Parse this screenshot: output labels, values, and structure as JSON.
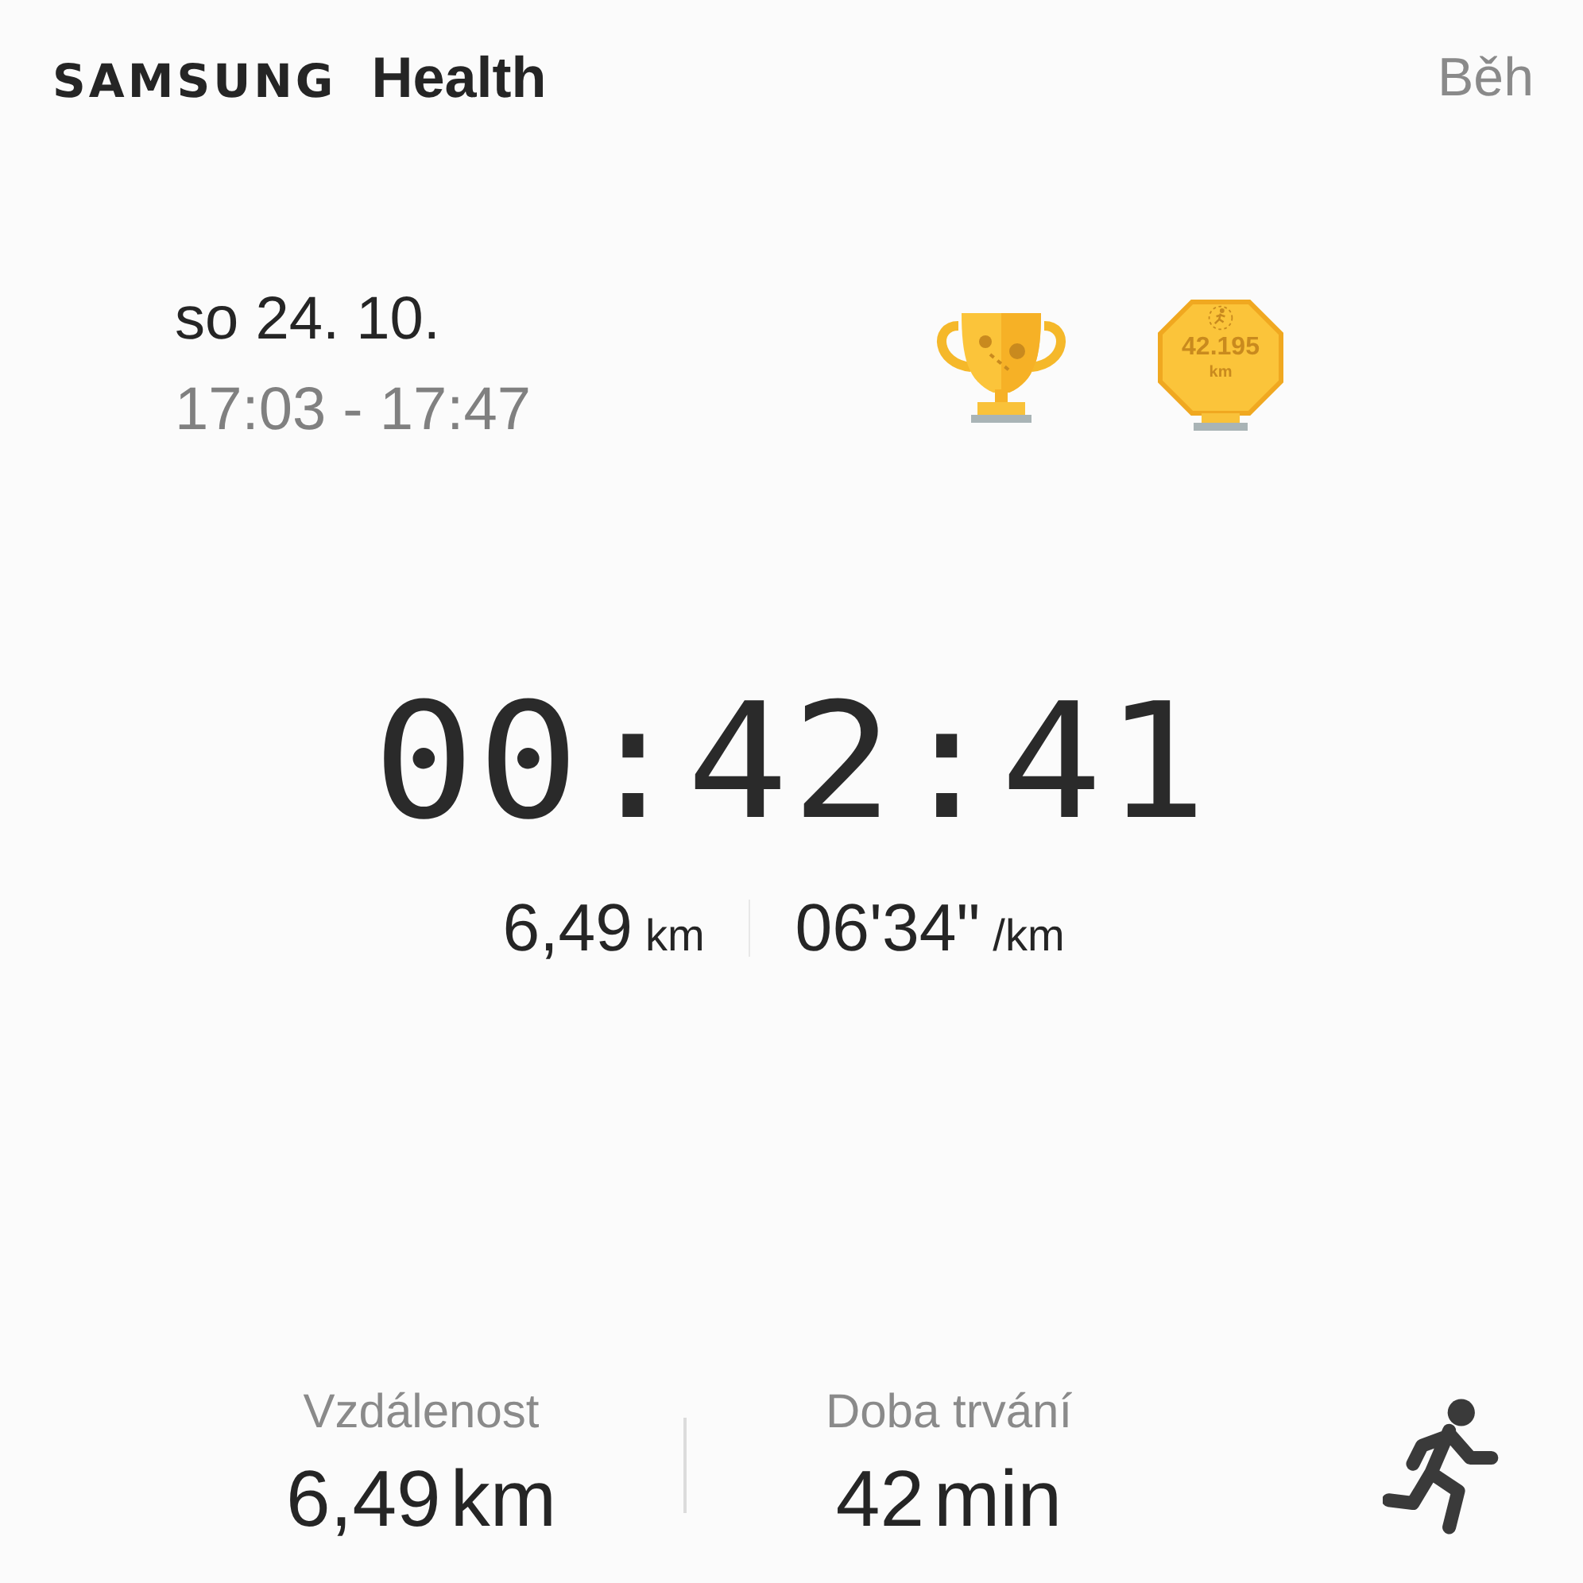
{
  "header": {
    "brand": "SAMSUNG",
    "app": "Health",
    "activity": "Běh"
  },
  "session": {
    "date": "so 24. 10.",
    "time_range": "17:03 - 17:47"
  },
  "awards": [
    {
      "kind": "trophy"
    },
    {
      "kind": "medal",
      "value": "42.195",
      "unit": "km"
    }
  ],
  "timer": "00:42:41",
  "summary": {
    "distance": "6,49",
    "distance_unit": "km",
    "pace": "06'34\"",
    "pace_unit": "/km"
  },
  "stats": [
    {
      "label": "Vzdálenost",
      "value": "6,49",
      "unit": "km"
    },
    {
      "label": "Doba trvání",
      "value": "42",
      "unit": "min"
    }
  ]
}
